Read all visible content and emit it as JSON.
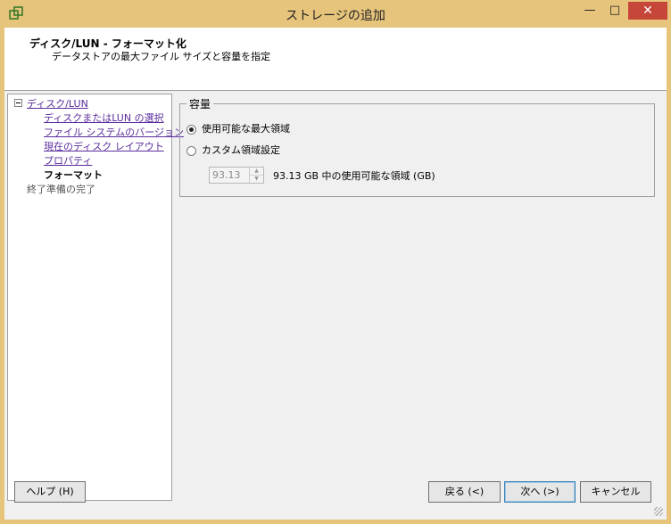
{
  "window": {
    "title": "ストレージの追加",
    "min_icon": "minimize-icon",
    "max_icon": "maximize-icon",
    "close_icon": "close-icon"
  },
  "header": {
    "title": "ディスク/LUN - フォーマット化",
    "subtitle": "データストアの最大ファイル サイズと容量を指定"
  },
  "nav": {
    "root": "ディスク/LUN",
    "items": [
      {
        "label": "ディスクまたはLUN の選択"
      },
      {
        "label": "ファイル システムのバージョン"
      },
      {
        "label": "現在のディスク レイアウト"
      },
      {
        "label": "プロパティ"
      },
      {
        "label": "フォーマット"
      },
      {
        "label": "終了準備の完了"
      }
    ]
  },
  "capacity": {
    "legend": "容量",
    "option_max": "使用可能な最大領域",
    "option_custom": "カスタム領域設定",
    "spin_value": "93.13",
    "spin_note": "93.13 GB 中の使用可能な領域 (GB)"
  },
  "buttons": {
    "help": "ヘルプ (H)",
    "back": "戻る (<)",
    "next": "次へ (>)",
    "cancel": "キャンセル"
  },
  "colors": {
    "frame": "#e6c47c",
    "close": "#c7463a",
    "link": "#5a2d9c"
  }
}
